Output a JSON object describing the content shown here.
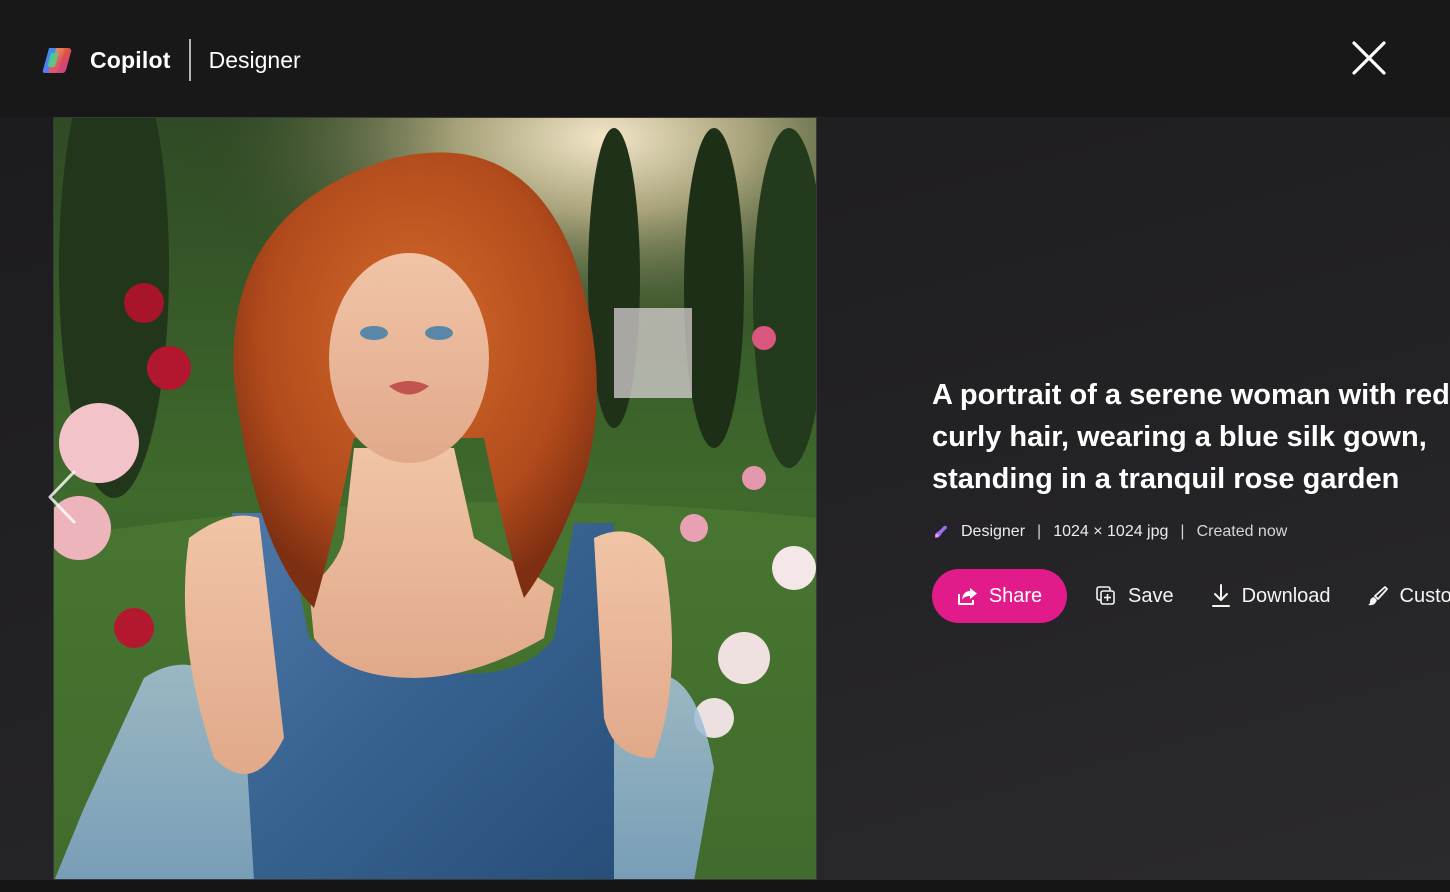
{
  "header": {
    "app_name": "Copilot",
    "section": "Designer"
  },
  "image": {
    "alt": "A portrait of a serene woman with red curly hair, wearing a blue silk gown, standing in a tranquil rose garden"
  },
  "details": {
    "title": "A portrait of a serene woman with red curly hair, wearing a blue silk gown, standing in a tranquil rose garden",
    "source": "Designer",
    "separator": "|",
    "dimensions": "1024 × 1024 jpg",
    "created": "Created now"
  },
  "actions": {
    "share": "Share",
    "save": "Save",
    "download": "Download",
    "customize": "Custo"
  },
  "colors": {
    "accent": "#e11c8a",
    "background": "#1a1a1a",
    "header": "#181818"
  }
}
